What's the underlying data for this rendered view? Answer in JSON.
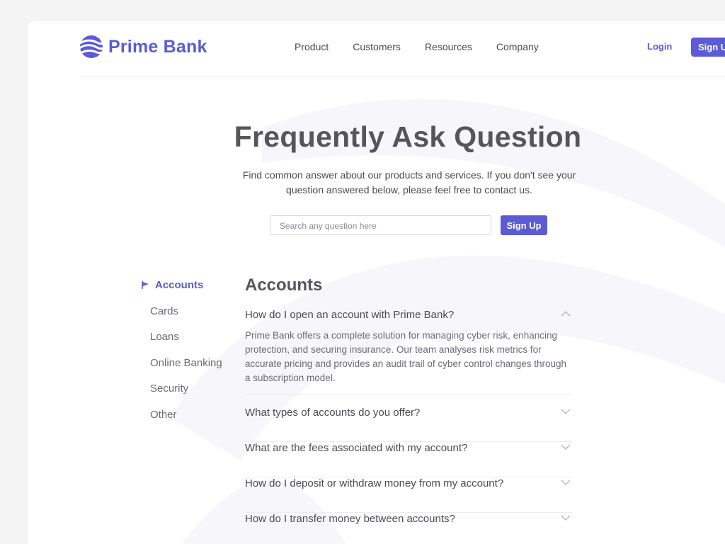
{
  "brand": {
    "name": "Prime Bank",
    "color": "#5b5bd6"
  },
  "nav": [
    "Product",
    "Customers",
    "Resources",
    "Company"
  ],
  "auth": {
    "login": "Login",
    "signup": "Sign Up"
  },
  "hero": {
    "title": "Frequently Ask Question",
    "subtitle": "Find common answer about our products and services. If you don't see your question answered below, please feel free to contact us."
  },
  "search": {
    "placeholder": "Search any question here",
    "button": "Sign Up"
  },
  "sidebar": {
    "items": [
      "Accounts",
      "Cards",
      "Loans",
      "Online Banking",
      "Security",
      "Other"
    ],
    "active": "Accounts"
  },
  "faq": {
    "section_title": "Accounts",
    "questions": [
      {
        "q": "How do I open an account with Prime Bank?",
        "expanded": true,
        "a": "Prime Bank offers a complete solution for managing cyber risk, enhancing protection, and securing insurance. Our team analyses risk metrics for accurate pricing and provides an audit trail of cyber control changes through a subscription model."
      },
      {
        "q": "What types of accounts do you offer?",
        "expanded": false
      },
      {
        "q": "What are the fees associated with my account?",
        "expanded": false
      },
      {
        "q": "How do I deposit or withdraw money from my account?",
        "expanded": false
      },
      {
        "q": "How do I transfer money between accounts?",
        "expanded": false
      }
    ]
  },
  "icons": {
    "logo": "wave-logo-icon",
    "flag": "flag-icon",
    "chevron_up": "chevron-up-icon",
    "chevron_down": "chevron-down-icon"
  }
}
